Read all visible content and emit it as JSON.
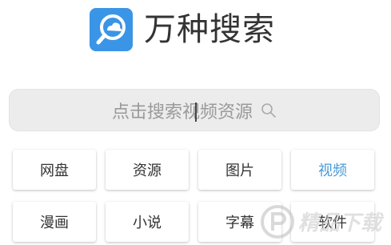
{
  "app": {
    "title": "万种搜索",
    "icon": "search-cloud-icon",
    "icon_color": "#3a95e6"
  },
  "search": {
    "placeholder": "点击搜索视频资源",
    "icon": "search-icon"
  },
  "categories": [
    {
      "label": "网盘",
      "selected": false
    },
    {
      "label": "资源",
      "selected": false
    },
    {
      "label": "图片",
      "selected": false
    },
    {
      "label": "视频",
      "selected": true
    },
    {
      "label": "漫画",
      "selected": false
    },
    {
      "label": "小说",
      "selected": false
    },
    {
      "label": "字幕",
      "selected": false
    },
    {
      "label": "软件",
      "selected": false
    }
  ],
  "colors": {
    "selected_text": "#4a9ad8",
    "normal_text": "#333333"
  },
  "watermark": {
    "text": "精品下载",
    "icon": "watermark-logo-icon"
  }
}
